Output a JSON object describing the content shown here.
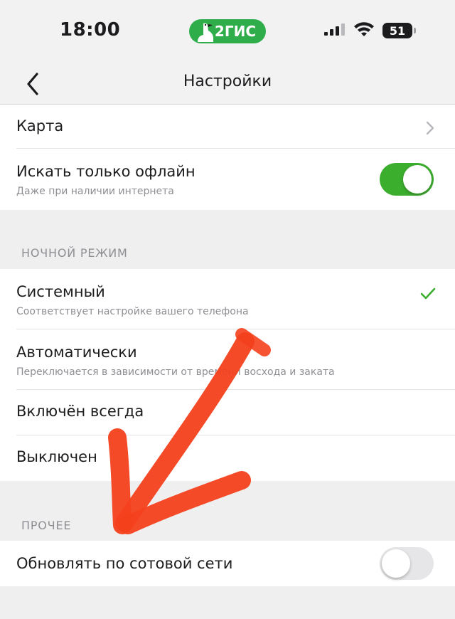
{
  "status_bar": {
    "time": "18:00",
    "brand": "2ГИС",
    "battery": "51"
  },
  "nav": {
    "title": "Настройки"
  },
  "general": {
    "map_label": "Карта",
    "offline_label": "Искать только офлайн",
    "offline_sub": "Даже при наличии интернета",
    "offline_on": true
  },
  "night_mode": {
    "header": "НОЧНОЙ РЕЖИМ",
    "items": [
      {
        "label": "Системный",
        "sub": "Соответствует настройке вашего телефона",
        "selected": true
      },
      {
        "label": "Автоматически",
        "sub": "Переключается в зависимости от времени восхода и заката"
      },
      {
        "label": "Включён всегда"
      },
      {
        "label": "Выключен"
      }
    ]
  },
  "other": {
    "header": "ПРОЧЕЕ",
    "cellular_label": "Обновлять по сотовой сети",
    "cellular_on": false
  },
  "colors": {
    "toggle_on": "#3cae2e",
    "check": "#3cae2e",
    "annotation_arrow": "#f4401c",
    "brand": "#2fad4a"
  },
  "icons": [
    "back-chevron-icon",
    "chevron-right-icon",
    "checkmark-icon",
    "signal-icon",
    "wifi-icon",
    "battery-icon",
    "goose-logo-icon"
  ]
}
